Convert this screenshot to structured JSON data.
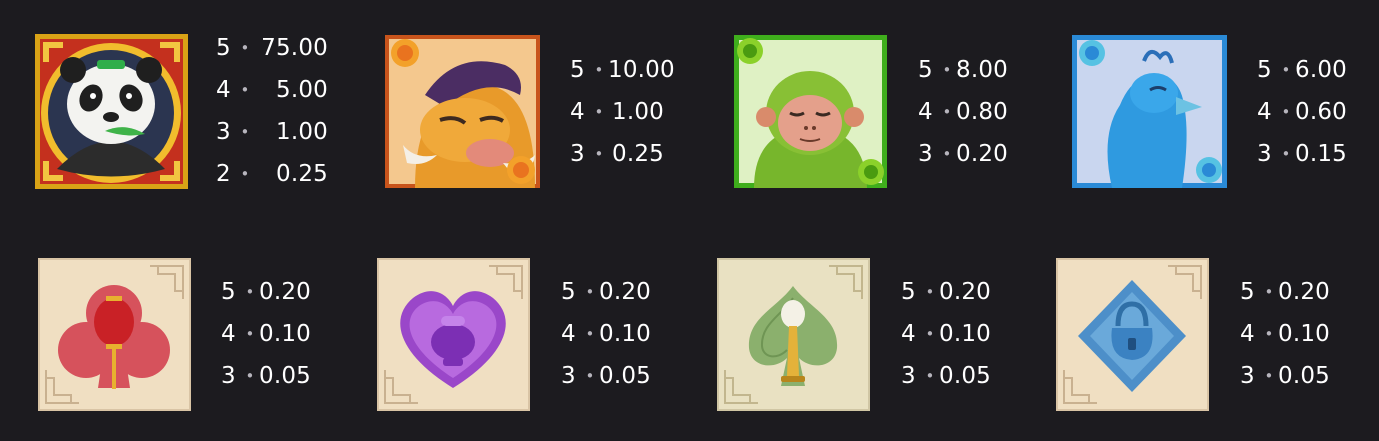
{
  "colors": {
    "background": "#1c1b1f",
    "text": "#ffffff"
  },
  "symbols": [
    {
      "icon": "panda-symbol",
      "pays": [
        {
          "count": "5",
          "value": "75.00"
        },
        {
          "count": "4",
          "value": "5.00"
        },
        {
          "count": "3",
          "value": "1.00"
        },
        {
          "count": "2",
          "value": "0.25"
        }
      ]
    },
    {
      "icon": "boar-symbol",
      "pays": [
        {
          "count": "5",
          "value": "10.00"
        },
        {
          "count": "4",
          "value": "1.00"
        },
        {
          "count": "3",
          "value": "0.25"
        }
      ]
    },
    {
      "icon": "monkey-symbol",
      "pays": [
        {
          "count": "5",
          "value": "8.00"
        },
        {
          "count": "4",
          "value": "0.80"
        },
        {
          "count": "3",
          "value": "0.20"
        }
      ]
    },
    {
      "icon": "peacock-symbol",
      "pays": [
        {
          "count": "5",
          "value": "6.00"
        },
        {
          "count": "4",
          "value": "0.60"
        },
        {
          "count": "3",
          "value": "0.15"
        }
      ]
    },
    {
      "icon": "club-lantern-symbol",
      "pays": [
        {
          "count": "5",
          "value": "0.20"
        },
        {
          "count": "4",
          "value": "0.10"
        },
        {
          "count": "3",
          "value": "0.05"
        }
      ]
    },
    {
      "icon": "heart-jar-symbol",
      "pays": [
        {
          "count": "5",
          "value": "0.20"
        },
        {
          "count": "4",
          "value": "0.10"
        },
        {
          "count": "3",
          "value": "0.05"
        }
      ]
    },
    {
      "icon": "spade-lotus-symbol",
      "pays": [
        {
          "count": "5",
          "value": "0.20"
        },
        {
          "count": "4",
          "value": "0.10"
        },
        {
          "count": "3",
          "value": "0.05"
        }
      ]
    },
    {
      "icon": "diamond-lock-symbol",
      "pays": [
        {
          "count": "5",
          "value": "0.20"
        },
        {
          "count": "4",
          "value": "0.10"
        },
        {
          "count": "3",
          "value": "0.05"
        }
      ]
    }
  ]
}
